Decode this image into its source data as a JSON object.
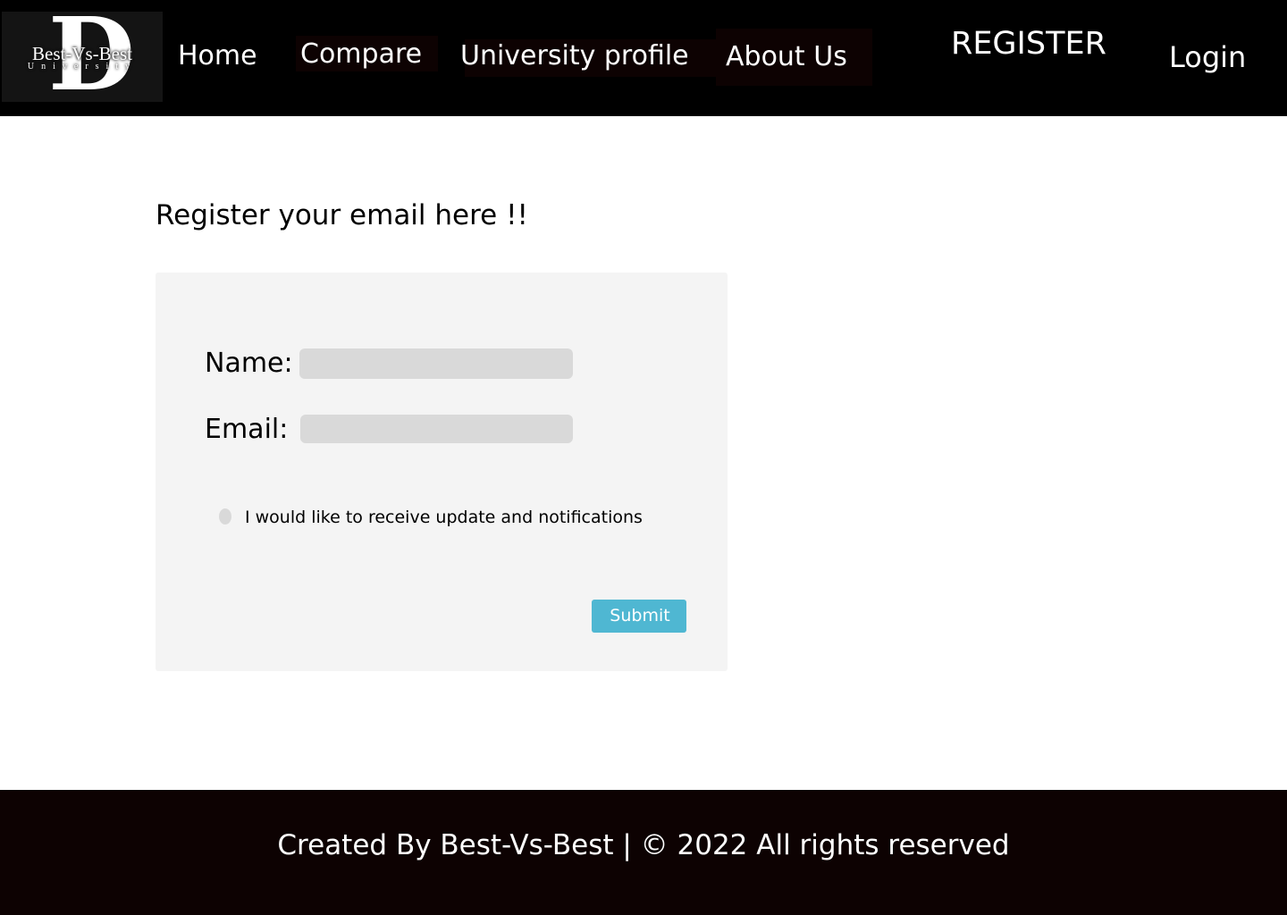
{
  "brand": {
    "logo_letter": "D",
    "logo_name": "Best-Vs-Best",
    "logo_sub": "University"
  },
  "nav": {
    "home": "Home",
    "compare": "Compare",
    "university_profile": "University profile",
    "about_us": "About Us",
    "register": "REGISTER",
    "login": "Login"
  },
  "main": {
    "heading": "Register your email here !!"
  },
  "form": {
    "name_label": "Name:",
    "name_value": "",
    "name_placeholder": "",
    "email_label": "Email:",
    "email_value": "",
    "email_placeholder": "",
    "notify_label": "I would like to receive update and notifications",
    "submit_label": "Submit"
  },
  "footer": {
    "text": "Created By Best-Vs-Best | © 2022 All rights reserved"
  },
  "colors": {
    "nav_bg": "#000000",
    "footer_bg": "#0d0202",
    "form_bg": "#f4f4f4",
    "input_bg": "#d9d9d9",
    "submit_bg": "#4fb7d2"
  }
}
